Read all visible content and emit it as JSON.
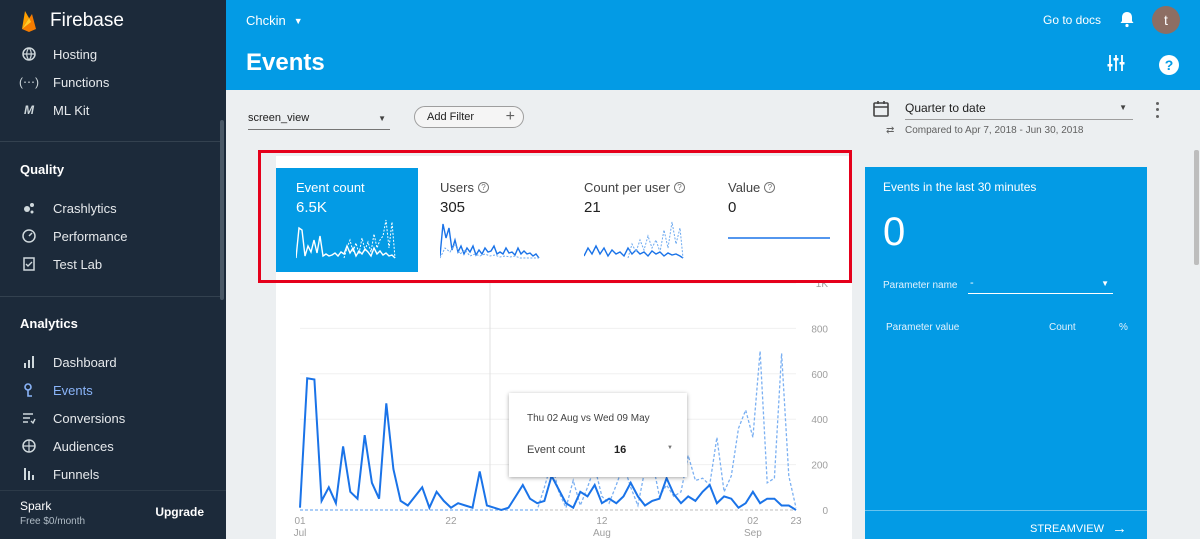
{
  "app": {
    "name": "Firebase"
  },
  "sidebar": {
    "top_items": [
      {
        "label": "Hosting",
        "icon": "globe-icon"
      },
      {
        "label": "Functions",
        "icon": "functions-icon"
      },
      {
        "label": "ML Kit",
        "icon": "ml-kit-icon"
      }
    ],
    "quality_title": "Quality",
    "quality_items": [
      {
        "label": "Crashlytics",
        "icon": "crashlytics-icon"
      },
      {
        "label": "Performance",
        "icon": "performance-icon"
      },
      {
        "label": "Test Lab",
        "icon": "test-lab-icon"
      }
    ],
    "analytics_title": "Analytics",
    "analytics_items": [
      {
        "label": "Dashboard",
        "icon": "bar-chart-icon"
      },
      {
        "label": "Events",
        "icon": "events-icon",
        "active": true
      },
      {
        "label": "Conversions",
        "icon": "conversions-icon"
      },
      {
        "label": "Audiences",
        "icon": "audiences-icon"
      },
      {
        "label": "Funnels",
        "icon": "funnels-icon"
      }
    ],
    "plan": {
      "name": "Spark",
      "desc": "Free $0/month",
      "upgrade": "Upgrade"
    }
  },
  "header": {
    "project": "Chckin",
    "title": "Events",
    "docs_link": "Go to docs",
    "avatar_letter": "t"
  },
  "toolbar": {
    "event_select": "screen_view",
    "add_filter": "Add Filter",
    "date_range": "Quarter to date",
    "compare_text": "Compared to Apr 7, 2018 - Jun 30, 2018"
  },
  "metrics": [
    {
      "label": "Event count",
      "value": "6.5K",
      "help": false
    },
    {
      "label": "Users",
      "value": "305",
      "help": true
    },
    {
      "label": "Count per user",
      "value": "21",
      "help": true
    },
    {
      "label": "Value",
      "value": "0",
      "help": true
    }
  ],
  "tooltip": {
    "title": "Thu 02 Aug vs Wed 09 May",
    "label": "Event count",
    "value": "16"
  },
  "chart_data": {
    "type": "line",
    "x_ticks": [
      {
        "day": "01",
        "month": "Jul"
      },
      {
        "day": "22",
        "month": ""
      },
      {
        "day": "12",
        "month": "Aug"
      },
      {
        "day": "02",
        "month": "Sep"
      },
      {
        "day": "23",
        "month": ""
      }
    ],
    "y_ticks": [
      "0",
      "200",
      "400",
      "600",
      "800",
      "1K"
    ],
    "ylim": [
      0,
      1000
    ],
    "series": [
      {
        "values": [
          10,
          580,
          575,
          40,
          100,
          30,
          280,
          80,
          50,
          330,
          120,
          50,
          470,
          180,
          40,
          20,
          60,
          100,
          10,
          80,
          40,
          10,
          30,
          20,
          10,
          170,
          20,
          10,
          0,
          10,
          60,
          110,
          50,
          30,
          40,
          150,
          90,
          30,
          10,
          80,
          60,
          110,
          30,
          50,
          30,
          60,
          120,
          60,
          20,
          40,
          50,
          140,
          70,
          30,
          60,
          40,
          80,
          110,
          30,
          60,
          50,
          10,
          30,
          80,
          30,
          50,
          50,
          20,
          20,
          0
        ]
      },
      {
        "values": [
          0,
          0,
          0,
          0,
          0,
          0,
          0,
          0,
          0,
          0,
          0,
          0,
          0,
          0,
          0,
          0,
          0,
          0,
          0,
          0,
          0,
          0,
          0,
          0,
          0,
          0,
          0,
          0,
          0,
          0,
          0,
          0,
          0,
          0,
          100,
          210,
          80,
          10,
          130,
          20,
          100,
          190,
          60,
          30,
          110,
          200,
          100,
          20,
          180,
          220,
          60,
          110,
          60,
          80,
          240,
          130,
          140,
          110,
          320,
          80,
          150,
          360,
          440,
          320,
          700,
          120,
          140,
          690,
          150,
          10
        ]
      }
    ]
  },
  "realtime": {
    "title": "Events in the last 30 minutes",
    "count": "0",
    "param_label": "Parameter name",
    "param_value": "-",
    "col_value": "Parameter value",
    "col_count": "Count",
    "col_pct": "%",
    "streamview": "STREAMVIEW"
  }
}
